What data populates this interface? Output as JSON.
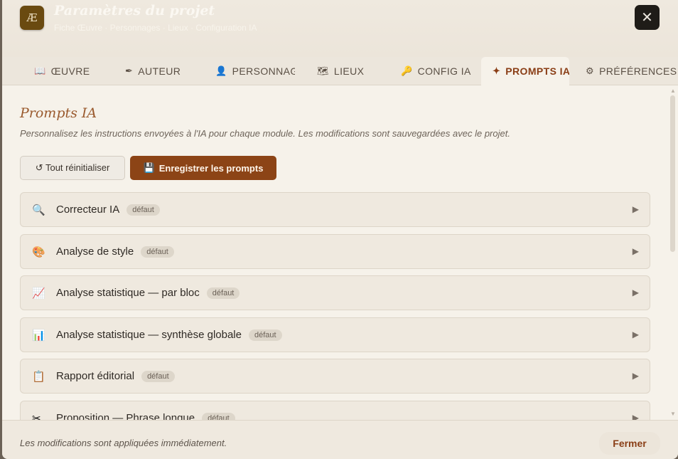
{
  "header": {
    "logo_text": "Æ",
    "title": "Paramètres du projet",
    "subtitle": "Fiche Œuvre · Personnages · Lieux · Configuration IA",
    "close_symbol": "✕"
  },
  "tabs": [
    {
      "icon": "📖",
      "icon_name": "book-icon",
      "label": "ŒUVRE"
    },
    {
      "icon": "✒",
      "icon_name": "pen-icon",
      "label": "AUTEUR"
    },
    {
      "icon": "👤",
      "icon_name": "person-icon",
      "label": "PERSONNAGES"
    },
    {
      "icon": "🗺",
      "icon_name": "map-icon",
      "label": "LIEUX"
    },
    {
      "icon": "🔑",
      "icon_name": "key-icon",
      "label": "CONFIG IA"
    },
    {
      "icon": "✦",
      "icon_name": "sparkle-icon",
      "label": "PROMPTS IA",
      "active": true
    },
    {
      "icon": "⚙",
      "icon_name": "gear-icon",
      "label": "PRÉFÉRENCES"
    }
  ],
  "section": {
    "title": "Prompts IA",
    "description": "Personnalisez les instructions envoyées à l'IA pour chaque module. Les modifications sont sauvegardées avec le projet."
  },
  "actions": {
    "reset_label": "↺ Tout réinitialiser",
    "save_icon": "💾",
    "save_label": "Enregistrer les prompts"
  },
  "prompts": [
    {
      "icon": "🔍",
      "icon_name": "magnifier-icon",
      "label": "Correcteur IA",
      "badge": "défaut"
    },
    {
      "icon": "🎨",
      "icon_name": "palette-icon",
      "label": "Analyse de style",
      "badge": "défaut"
    },
    {
      "icon": "📈",
      "icon_name": "line-chart-icon",
      "label": "Analyse statistique — par bloc",
      "badge": "défaut"
    },
    {
      "icon": "📊",
      "icon_name": "bar-chart-icon",
      "label": "Analyse statistique — synthèse globale",
      "badge": "défaut"
    },
    {
      "icon": "📋",
      "icon_name": "clipboard-icon",
      "label": "Rapport éditorial",
      "badge": "défaut"
    },
    {
      "icon": "✂",
      "icon_name": "scissors-icon",
      "label": "Proposition — Phrase longue",
      "badge": "défaut"
    }
  ],
  "chevron": "▶",
  "footer": {
    "note": "Les modifications sont appliquées immédiatement.",
    "close_label": "Fermer"
  }
}
